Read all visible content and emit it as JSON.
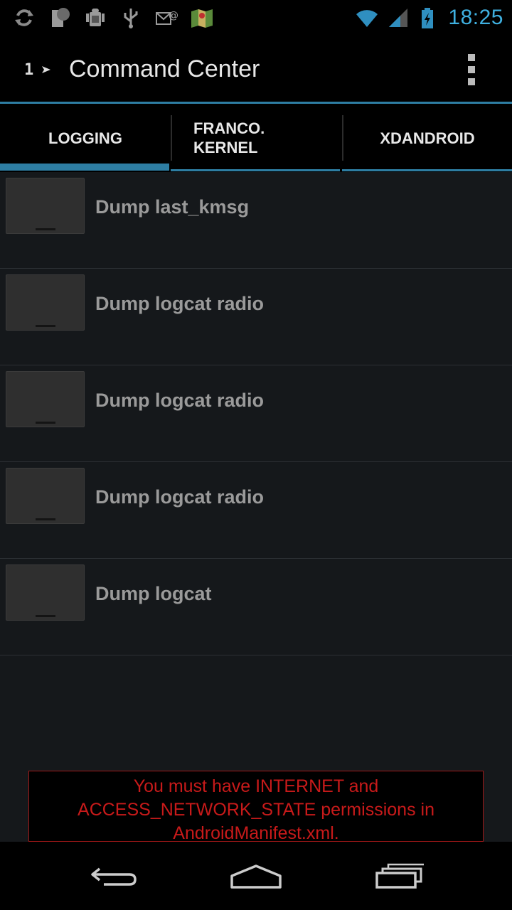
{
  "status_bar": {
    "time": "18:25",
    "icons": [
      "sync-icon",
      "sim-icon",
      "android-debug-icon",
      "usb-icon",
      "email-icon",
      "maps-icon"
    ],
    "right_icons": [
      "wifi-icon",
      "signal-icon",
      "battery-charging-icon"
    ]
  },
  "action_bar": {
    "title": "Command Center",
    "logo_text": "1",
    "overflow_icon": "overflow-menu-icon"
  },
  "tabs": [
    {
      "label": "LOGGING",
      "selected": true
    },
    {
      "label": "FRANCO.\nKERNEL",
      "selected": false
    },
    {
      "label": "XDANDROID",
      "selected": false
    }
  ],
  "list": {
    "items": [
      {
        "label": "Dump last_kmsg"
      },
      {
        "label": "Dump logcat radio"
      },
      {
        "label": "Dump logcat radio"
      },
      {
        "label": "Dump logcat radio"
      },
      {
        "label": "Dump logcat"
      }
    ]
  },
  "warning": {
    "text": "You must have INTERNET and ACCESS_NETWORK_STATE permissions in AndroidManifest.xml."
  },
  "colors": {
    "accent": "#2e7ea3",
    "status_time": "#3fb0e0",
    "warning": "#c81a1a"
  },
  "nav_bar": {
    "buttons": [
      "back-icon",
      "home-icon",
      "recent-apps-icon"
    ]
  }
}
